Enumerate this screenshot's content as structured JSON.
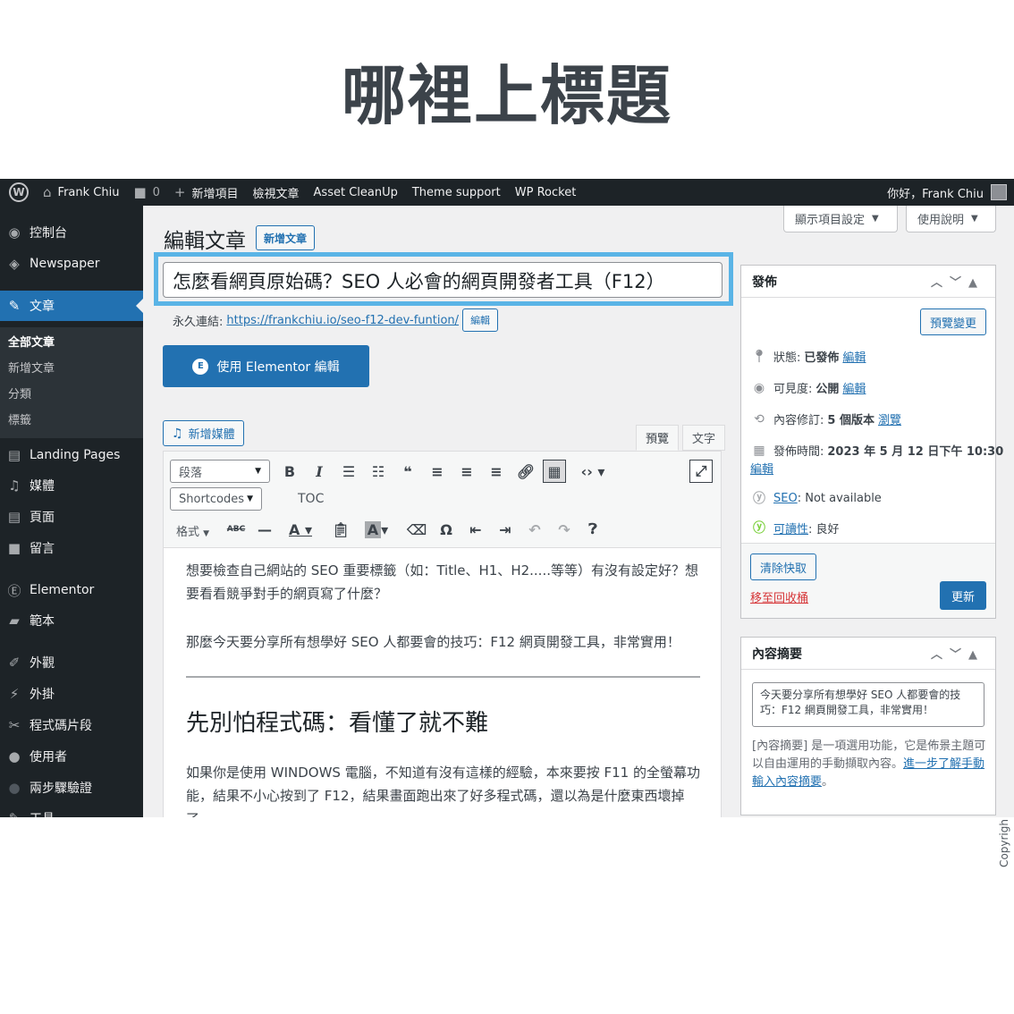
{
  "heading": "哪裡上標題",
  "adminbar": {
    "wp_logo": "W",
    "site_name": "Frank Chiu",
    "comments_count": "0",
    "new_item": "新增項目",
    "view_post": "檢視文章",
    "asset_cleanup": "Asset CleanUp",
    "theme_support": "Theme support",
    "wp_rocket": "WP Rocket",
    "greeting": "你好，Frank Chiu"
  },
  "sidebar": {
    "dashboard": "控制台",
    "newspaper": "Newspaper",
    "posts": "文章",
    "sub_all_posts": "全部文章",
    "sub_add_new": "新增文章",
    "sub_categories": "分類",
    "sub_tags": "標籤",
    "landing_pages": "Landing Pages",
    "media": "媒體",
    "pages": "頁面",
    "comments": "留言",
    "elementor": "Elementor",
    "templates": "範本",
    "appearance": "外觀",
    "plugins": "外掛",
    "code_snippets": "程式碼片段",
    "users": "使用者",
    "two_factor": "兩步驟驗證",
    "tools": "工具"
  },
  "screen": {
    "screen_options": "顯示項目設定",
    "help": "使用說明"
  },
  "editor": {
    "page_heading": "編輯文章",
    "add_new": "新增文章",
    "title": "怎麼看網頁原始碼？SEO 人必會的網頁開發者工具（F12）",
    "permalink_label": "永久連結:",
    "permalink_url": "https://frankchiu.io/seo-f12-dev-funtion/",
    "permalink_edit": "編輯",
    "elementor_button": "使用 Elementor 編輯",
    "add_media": "新增媒體",
    "tab_visual": "預覽",
    "tab_text": "文字",
    "format_select": "段落",
    "shortcodes_select": "Shortcodes",
    "toc": "TOC",
    "format_menu": "格式",
    "content": {
      "p1": "想要檢查自己網站的 SEO 重要標籤（如：Title、H1、H2.....等等）有沒有設定好？想要看看競爭對手的網頁寫了什麼？",
      "p2": "那麼今天要分享所有想學好 SEO 人都要會的技巧：F12 網頁開發工具，非常實用！",
      "h2": "先別怕程式碼：看懂了就不難",
      "p3": "如果你是使用 WINDOWS 電腦，不知道有沒有這樣的經驗，本來要按 F11 的全螢幕功能，結果不小心按到了 F12，結果畫面跑出來了好多程式碼，還以為是什麼東西壞掉了。"
    }
  },
  "publish": {
    "title": "發佈",
    "preview_changes": "預覽變更",
    "status_label": "狀態:",
    "status_value": "已發佈",
    "status_edit": "編輯",
    "visibility_label": "可見度:",
    "visibility_value": "公開",
    "visibility_edit": "編輯",
    "revisions_label": "內容修訂:",
    "revisions_value": "5 個版本",
    "revisions_browse": "瀏覽",
    "published_label": "發佈時間:",
    "published_value": "2023 年 5 月 12 日下午 10:30",
    "published_edit": "編輯",
    "seo_label": "SEO",
    "seo_value": ": Not available",
    "readability_label": "可讀性",
    "readability_value": ": 良好",
    "clear_cache": "清除快取",
    "trash": "移至回收桶",
    "update": "更新"
  },
  "excerpt": {
    "title": "內容摘要",
    "text": "今天要分享所有想學好 SEO 人都要會的技巧：F12 網頁開發工具，非常實用！",
    "help_prefix": "[內容摘要] 是一項選用功能，它是佈景主題可以自由運用的手動擷取內容。",
    "help_link": "進一步了解手動輸入內容摘要",
    "help_suffix": "。"
  },
  "copyright": "Copyrigh"
}
